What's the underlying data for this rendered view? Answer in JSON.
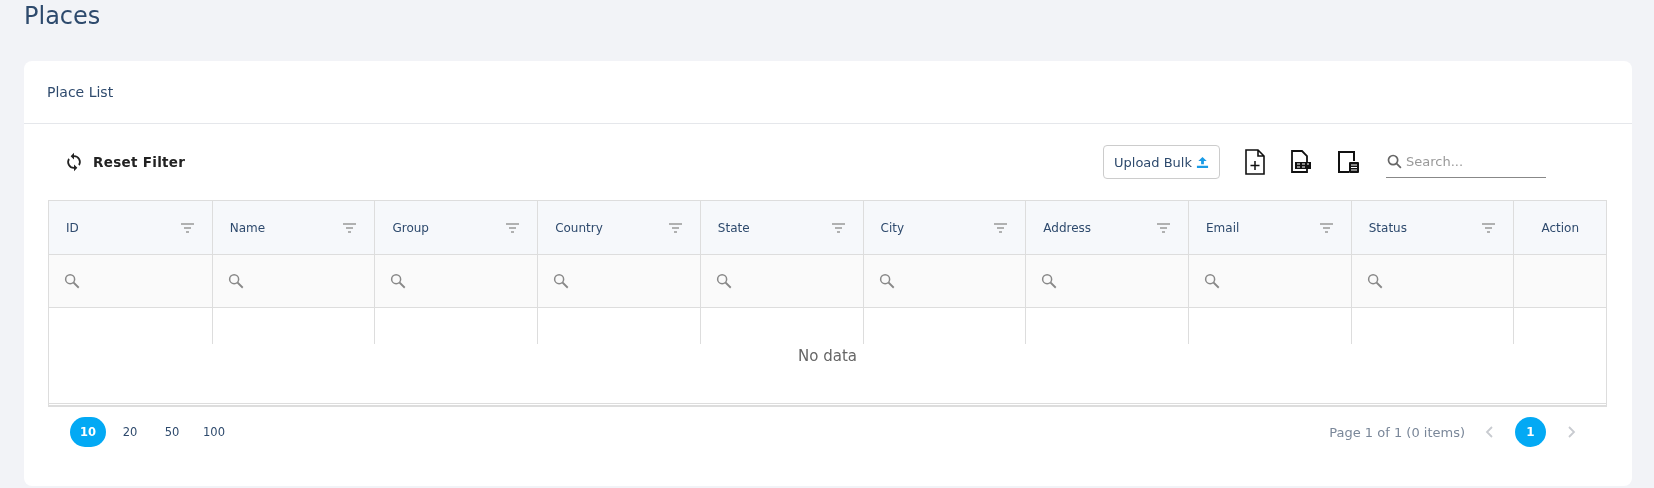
{
  "page_title": "Places",
  "card": {
    "title": "Place List"
  },
  "toolbar": {
    "reset_label": "Reset Filter",
    "upload_label": "Upload Bulk",
    "search": {
      "placeholder": "Search..."
    }
  },
  "table": {
    "columns": [
      {
        "label": "ID",
        "filterable": true
      },
      {
        "label": "Name",
        "filterable": true
      },
      {
        "label": "Group",
        "filterable": true
      },
      {
        "label": "Country",
        "filterable": true
      },
      {
        "label": "State",
        "filterable": true
      },
      {
        "label": "City",
        "filterable": true
      },
      {
        "label": "Address",
        "filterable": true
      },
      {
        "label": "Email",
        "filterable": true
      },
      {
        "label": "Status",
        "filterable": true
      },
      {
        "label": "Action",
        "filterable": false
      }
    ],
    "empty_text": "No data"
  },
  "pagination": {
    "page_sizes": [
      {
        "label": "10",
        "selected": true
      },
      {
        "label": "20",
        "selected": false
      },
      {
        "label": "50",
        "selected": false
      },
      {
        "label": "100",
        "selected": false
      }
    ],
    "info": "Page 1 of 1 (0 items)",
    "prev": {
      "disabled": true
    },
    "pages": [
      {
        "label": "1",
        "selected": true
      }
    ],
    "next": {
      "disabled": true
    }
  }
}
